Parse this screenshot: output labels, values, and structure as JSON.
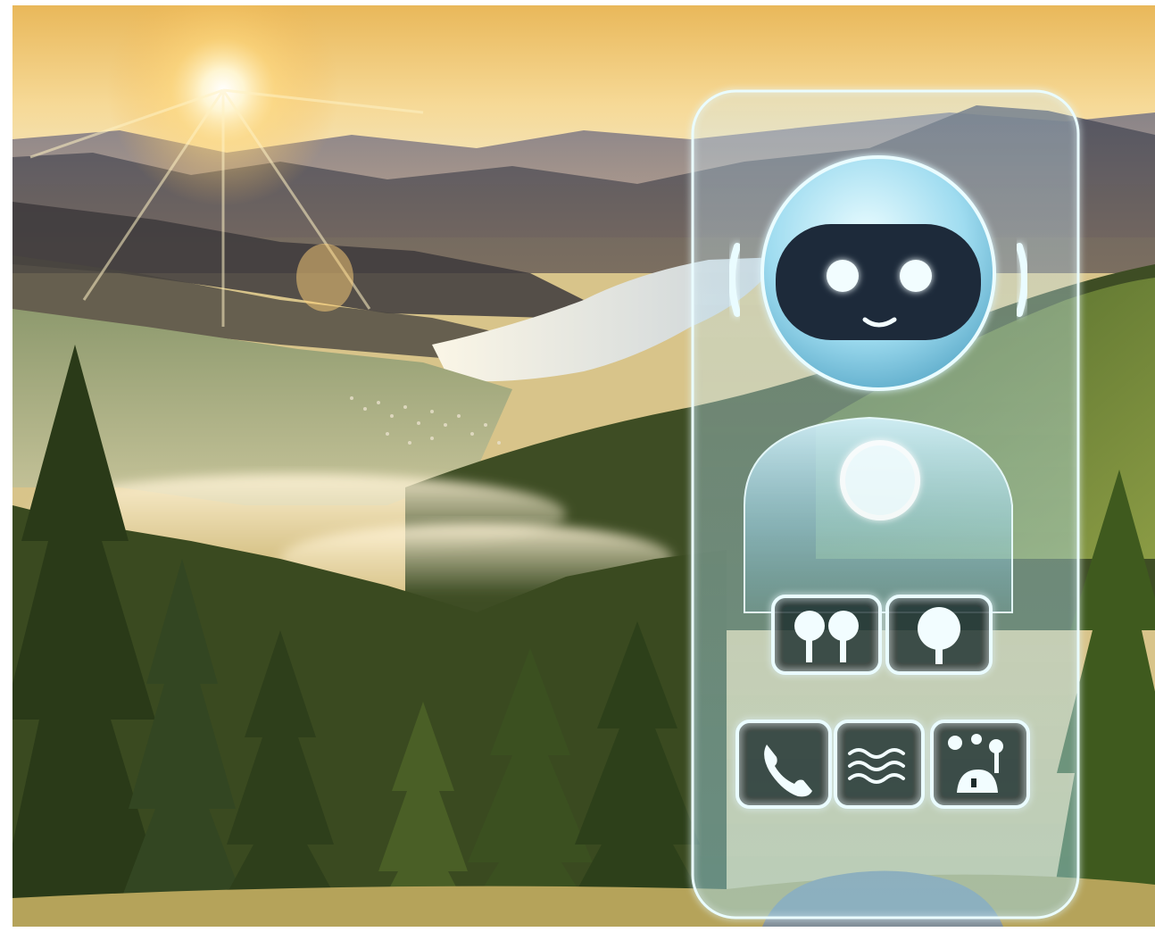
{
  "scene": {
    "subject": "robot-assistant",
    "background": "mountain-valley-at-sunrise",
    "colors": {
      "sky_top": "#f4c66a",
      "sky_horizon": "#f7e2a8",
      "sun": "#fff6d8",
      "lake": "#f3efe0",
      "far_mountains": "#5a6178",
      "mid_hills": "#3b4a4a",
      "forest_dark": "#1e2b18",
      "forest_light": "#5c7a2c",
      "glass_edge": "#e6fbff",
      "robot_glow": "#bff3ff",
      "robot_visor": "#1d2a3a"
    }
  },
  "assistant_panel": {
    "top_row_icons": [
      "trees-icon",
      "oak-tree-icon"
    ],
    "bottom_row_icons": [
      "phone-icon",
      "waves-icon",
      "settings-alert-icon"
    ]
  }
}
